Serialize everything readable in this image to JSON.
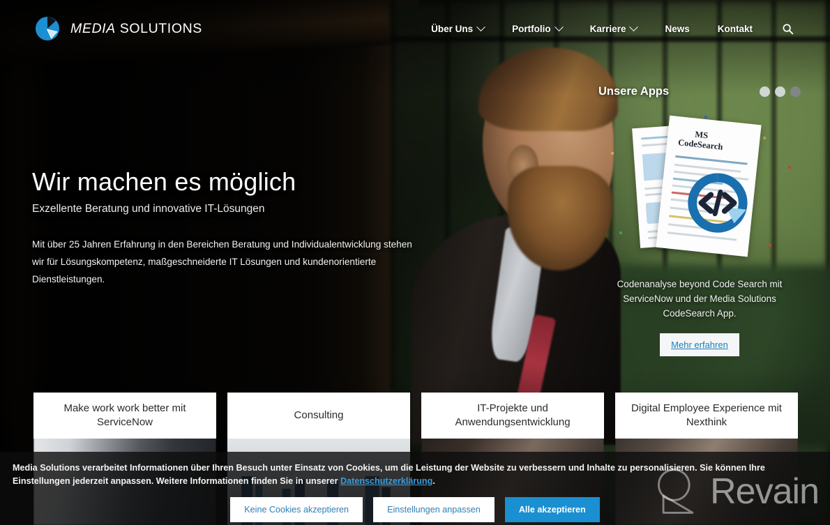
{
  "brand": {
    "logo_icon": "pie-chart-logo-icon",
    "name_italic": "MEDIA",
    "name_bold": " SOLUTIONS",
    "accent_blue": "#1a8fd1",
    "logo_blue": "#1a8fd1",
    "logo_light_blue": "#bfe3f5"
  },
  "nav": {
    "items": [
      {
        "label": "Über Uns",
        "has_dropdown": true
      },
      {
        "label": "Portfolio",
        "has_dropdown": true
      },
      {
        "label": "Karriere",
        "has_dropdown": true
      },
      {
        "label": "News",
        "has_dropdown": false
      },
      {
        "label": "Kontakt",
        "has_dropdown": false
      }
    ],
    "search_icon": "search-icon"
  },
  "hero": {
    "title": "Wir machen es möglich",
    "subtitle": "Exzellente Beratung und innovative IT-Lösungen",
    "body": "Mit über 25 Jahren Erfahrung in den Bereichen Beratung und Individualentwicklung stehen wir für Lösungskompetenz, maßgeschneiderte IT Lösungen und kundenorientierte Dienstleistungen."
  },
  "apps": {
    "title": "Unsere Apps",
    "slide_count": 3,
    "active_slide": 3,
    "illustration_label_line1": "MS",
    "illustration_label_line2": "CodeSearch",
    "description": "Codenanalyse beyond Code Search mit ServiceNow und der Media Solutions CodeSearch App.",
    "cta_label": "Mehr erfahren"
  },
  "cards": [
    {
      "title": "Make work work better mit ServiceNow"
    },
    {
      "title": "Consulting"
    },
    {
      "title": "IT-Projekte und Anwendungsentwicklung"
    },
    {
      "title": "Digital Employee Experience mit Nexthink"
    }
  ],
  "cookie": {
    "text_part1": "Media Solutions verarbeitet Informationen über Ihren Besuch unter Einsatz von Cookies, um die Leistung der Website zu verbessern und Inhalte zu personalisieren. Sie können Ihre Einstellungen jederzeit anpassen. Weitere Informationen finden Sie in unserer ",
    "link_label": "Datenschutzerklärung",
    "text_part2": ".",
    "buttons": {
      "reject": "Keine Cookies akzeptieren",
      "customize": "Einstellungen anpassen",
      "accept_all": "Alle akzeptieren"
    }
  },
  "watermark": {
    "text": "Revain",
    "icon": "revain-logo-icon"
  }
}
